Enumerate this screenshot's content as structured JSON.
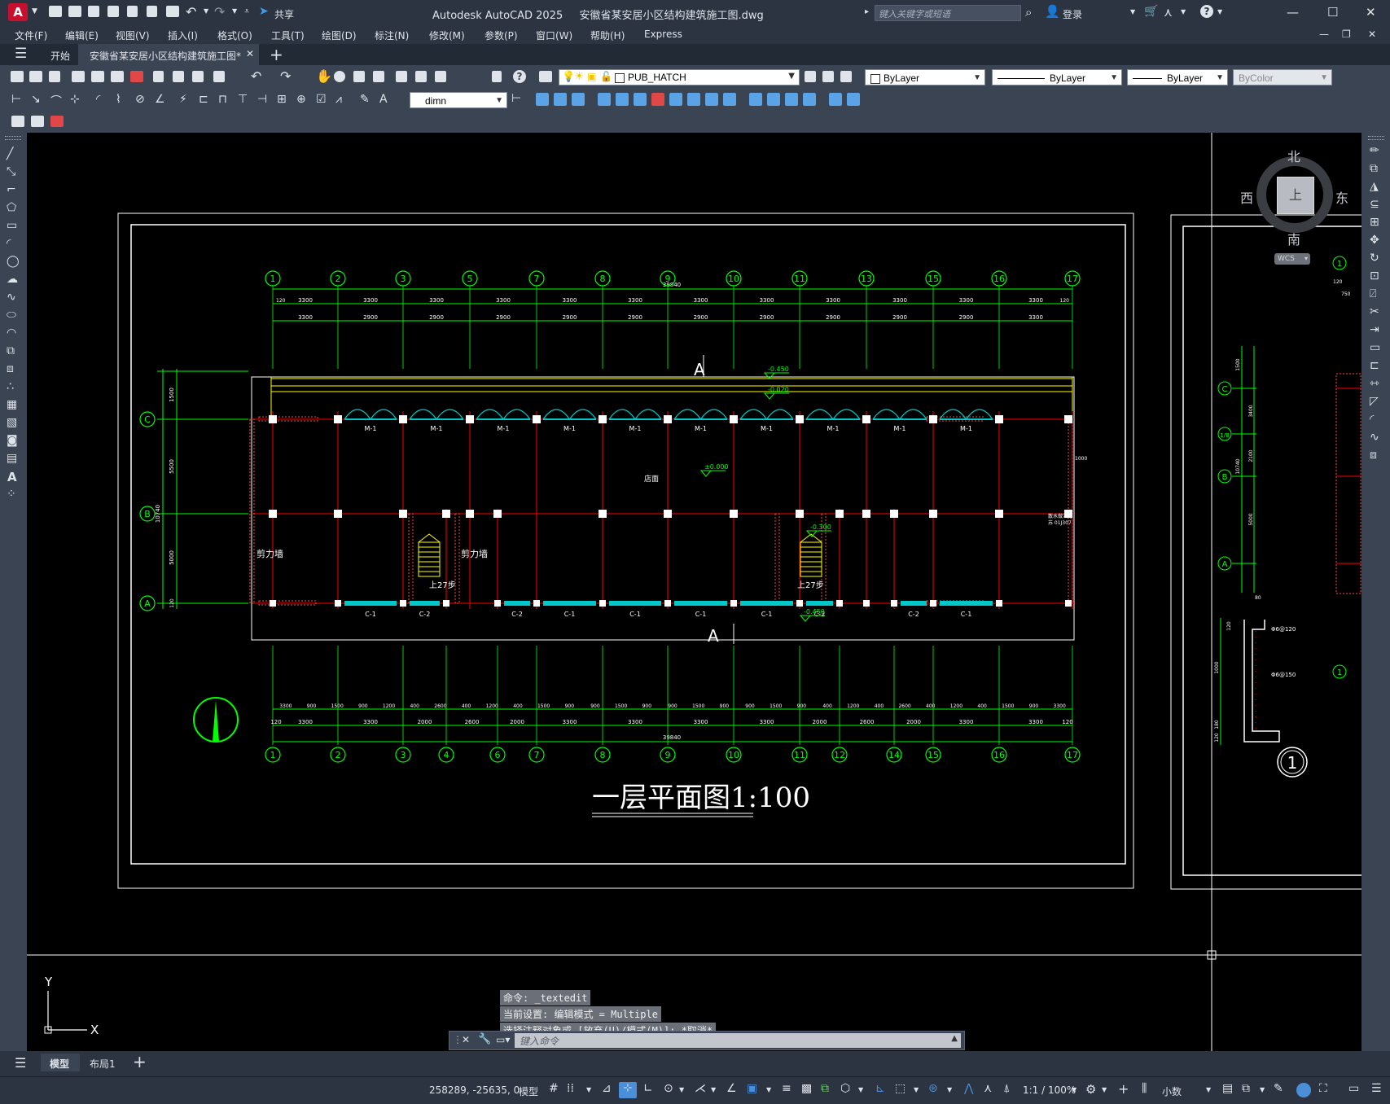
{
  "window": {
    "app_name": "Autodesk AutoCAD 2025",
    "file_name": "安徽省某安居小区结构建筑施工图.dwg",
    "search_placeholder": "键入关键字或短语",
    "login_label": "登录",
    "share_label": "共享"
  },
  "menu": [
    "文件(F)",
    "编辑(E)",
    "视图(V)",
    "插入(I)",
    "格式(O)",
    "工具(T)",
    "绘图(D)",
    "标注(N)",
    "修改(M)",
    "参数(P)",
    "窗口(W)",
    "帮助(H)",
    "Express"
  ],
  "tabs": {
    "start": "开始",
    "document": "安徽省某安居小区结构建筑施工图*"
  },
  "ribbon": {
    "layer_name": "PUB_HATCH",
    "color": "ByLayer",
    "linetype": "ByLayer",
    "lineweight": "ByLayer",
    "plotstyle": "ByColor",
    "dimstyle": "dimn"
  },
  "drawing": {
    "title": "一层平面图1:100",
    "axes_top": [
      "1",
      "2",
      "3",
      "5",
      "7",
      "8",
      "9",
      "10",
      "11",
      "13",
      "15",
      "16",
      "17"
    ],
    "axes_bottom": [
      "1",
      "2",
      "3",
      "4",
      "6",
      "7",
      "8",
      "9",
      "10",
      "11",
      "12",
      "14",
      "15",
      "16",
      "17"
    ],
    "axes_left": [
      "C",
      "B",
      "A"
    ],
    "total_length": "39840",
    "top_dim_row1": [
      "120",
      "3300",
      "3300",
      "3300",
      "3300",
      "3300",
      "3300",
      "3300",
      "3300",
      "3300",
      "3300",
      "3300",
      "3300",
      "120"
    ],
    "top_dim_row2": [
      "3300",
      "2900",
      "2900",
      "2900",
      "2900",
      "2900",
      "2900",
      "2900",
      "2900",
      "2900",
      "2900",
      "3300"
    ],
    "bottom_dim_row1": [
      "3300",
      "900",
      "1500",
      "900",
      "1200",
      "400",
      "2600",
      "400",
      "1200",
      "400",
      "1500",
      "900",
      "900",
      "1500",
      "900",
      "900",
      "1500",
      "900",
      "900",
      "1500",
      "900",
      "400",
      "1200",
      "400",
      "2600",
      "400",
      "1200",
      "400",
      "1500",
      "900",
      "3300"
    ],
    "bottom_dim_row2": [
      "120",
      "3300",
      "3300",
      "2000",
      "2600",
      "2000",
      "3300",
      "3300",
      "3300",
      "3300",
      "2000",
      "2600",
      "2000",
      "3300",
      "3300",
      "120"
    ],
    "left_dims": [
      "1500",
      "5500",
      "10740",
      "5000",
      "120"
    ],
    "door_label": "M-1",
    "window_labels": [
      "C-1",
      "C-2",
      "C-2",
      "C-1",
      "C-1",
      "C-1",
      "C-1",
      "C-2",
      "C-2",
      "C-1"
    ],
    "room_label": "店面",
    "shear_wall_label": "剪力墙",
    "stair_label": "上27步",
    "elevations": [
      "-0.450",
      "-0.020",
      "±0.000",
      "-0.300",
      "-0.450"
    ],
    "section_mark": "A",
    "side_labels": [
      "散水做法见",
      "苏 01J307",
      "1000"
    ],
    "right_axes": [
      "1",
      "C",
      "1/B",
      "B",
      "A",
      "1"
    ],
    "right_dims": [
      "3400",
      "2100",
      "5000",
      "10740",
      "1500",
      "120",
      "750"
    ],
    "rebar_labels": [
      "Φ6@120",
      "Φ6@150",
      "80",
      "120",
      "1000",
      "180",
      "120"
    ],
    "detail_number": "1"
  },
  "viewcube": {
    "north": "北",
    "south": "南",
    "east": "东",
    "west": "西",
    "top": "上",
    "wcs": "WCS"
  },
  "command": {
    "history": [
      "命令: _textedit",
      "当前设置: 编辑模式 = Multiple",
      "选择注释对象或 [放弃(U)/模式(M)]: *取消*"
    ],
    "placeholder": "键入命令"
  },
  "layout_tabs": [
    "模型",
    "布局1"
  ],
  "status": {
    "coords": "258289, -25635, 0",
    "model": "模型",
    "scale": "1:1 / 100%",
    "units": "小数"
  },
  "colors": {
    "accent_red": "#c8102e",
    "drawing_green": "#00ff00",
    "axis_red": "#ff0000",
    "yellow": "#ffff00",
    "cyan": "#00c8c8"
  }
}
